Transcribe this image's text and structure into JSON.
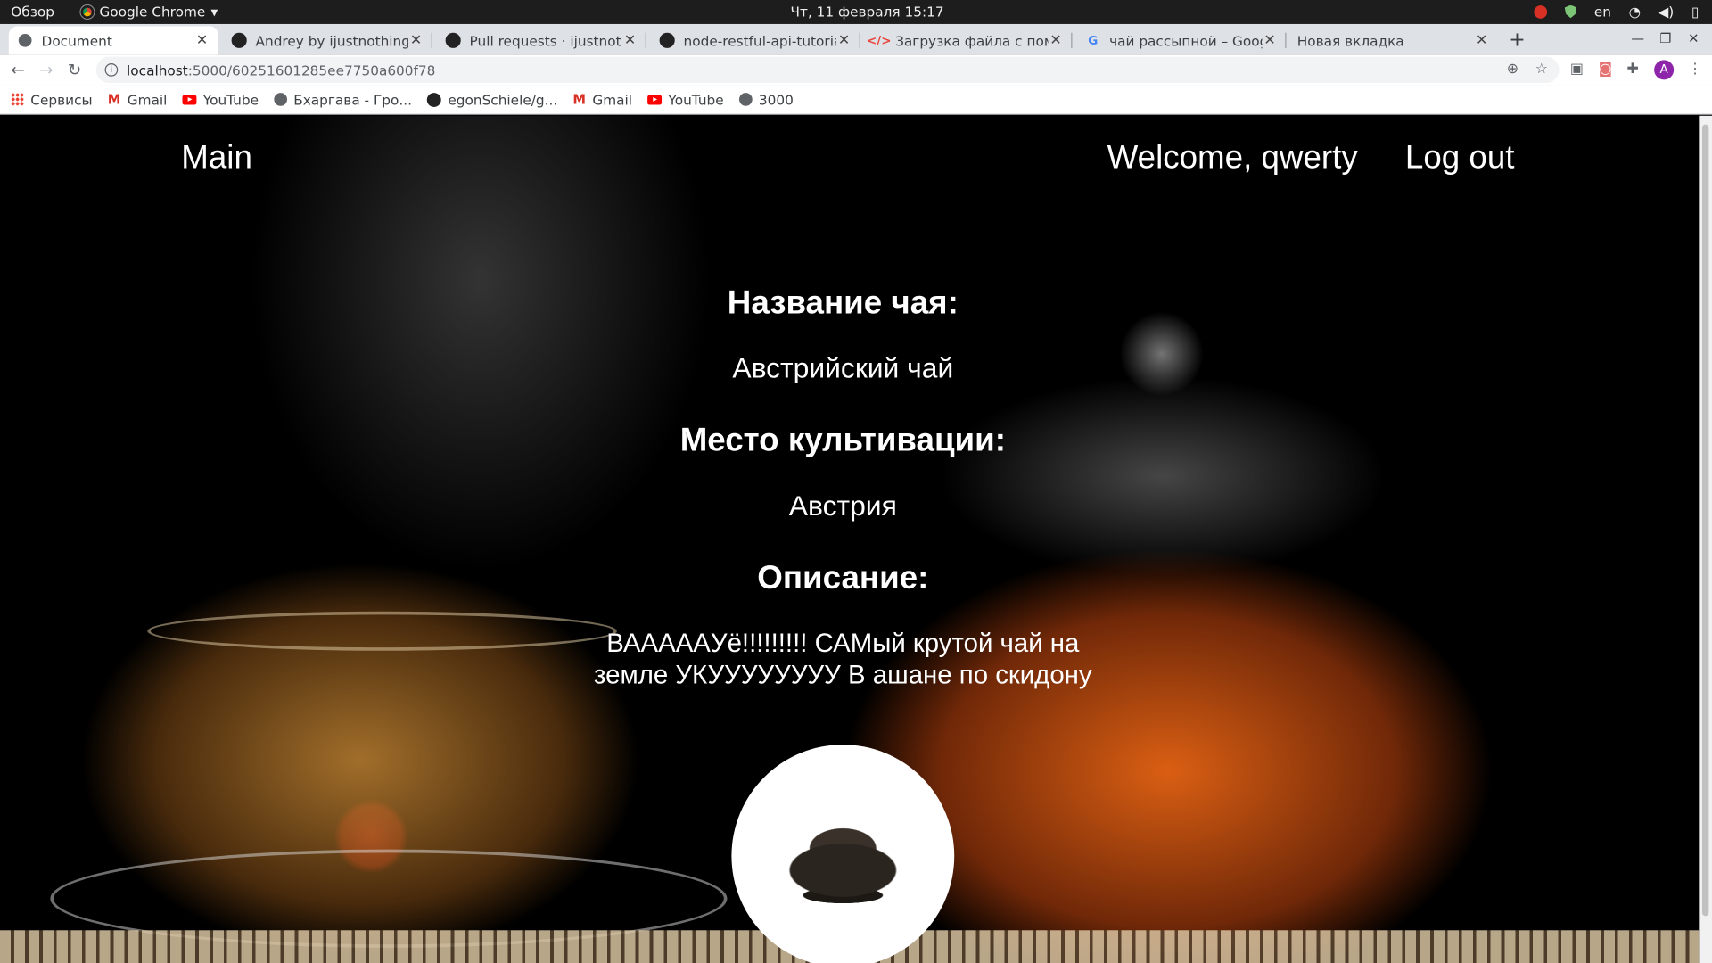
{
  "os_bar": {
    "activities": "Обзор",
    "app_name": "Google Chrome",
    "clock": "Чт, 11 февраля  15:17",
    "language": "en"
  },
  "tabs": [
    {
      "title": "Document",
      "active": true,
      "icon": "globe-icon"
    },
    {
      "title": "Andrey by ijustnothing · P",
      "icon": "github-icon"
    },
    {
      "title": "Pull requests · ijustnothin",
      "icon": "github-icon"
    },
    {
      "title": "node-restful-api-tutorial/",
      "icon": "github-icon"
    },
    {
      "title": "Загрузка файла с помощ",
      "icon": "code-icon"
    },
    {
      "title": "чай рассыпной – Google",
      "icon": "google-icon"
    },
    {
      "title": "Новая вкладка",
      "icon": "none"
    }
  ],
  "address": {
    "host": "localhost",
    "path": ":5000/60251601285ee7750a600f78"
  },
  "profile_initial": "A",
  "bookmarks": [
    {
      "label": "Сервисы",
      "icon": "apps-icon"
    },
    {
      "label": "Gmail",
      "icon": "gmail-icon"
    },
    {
      "label": "YouTube",
      "icon": "youtube-icon"
    },
    {
      "label": "Бхаргава - Гро...",
      "icon": "globe-icon"
    },
    {
      "label": "egonSchiele/g...",
      "icon": "github-icon"
    },
    {
      "label": "Gmail",
      "icon": "gmail-icon"
    },
    {
      "label": "YouTube",
      "icon": "youtube-icon"
    },
    {
      "label": "3000",
      "icon": "globe-icon"
    }
  ],
  "site_nav": {
    "main": "Main",
    "welcome": "Welcome, qwerty",
    "logout": "Log out"
  },
  "tea": {
    "name_heading": "Название чая:",
    "name": "Австрийский чай",
    "place_heading": "Место культивации:",
    "place": "Австрия",
    "description_heading": "Описание:",
    "description": "ВААААAУё!!!!!!!!! САМый крутой чай на земле УКУУУУУУУУ В ашане по скидону"
  }
}
